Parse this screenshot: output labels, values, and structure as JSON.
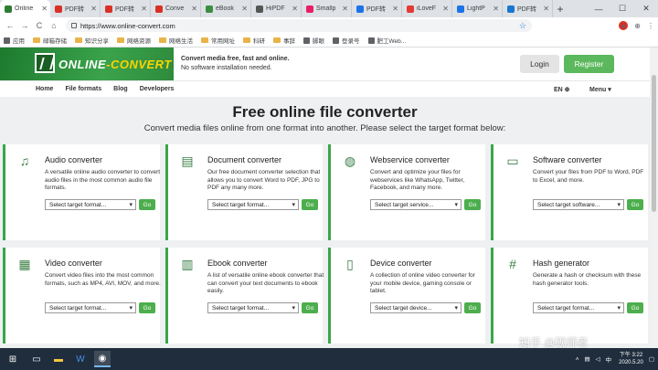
{
  "browser": {
    "tabs": [
      {
        "title": "Online",
        "color": "#2e7d32",
        "active": true
      },
      {
        "title": "PDF转",
        "color": "#d93025",
        "active": false
      },
      {
        "title": "PDF转",
        "color": "#d93025",
        "active": false
      },
      {
        "title": "Conve",
        "color": "#d93025",
        "active": false
      },
      {
        "title": "eBook",
        "color": "#3c8d40",
        "active": false
      },
      {
        "title": "HiPDF",
        "color": "#555555",
        "active": false
      },
      {
        "title": "Smallp",
        "color": "#e91e63",
        "active": false
      },
      {
        "title": "PDF转",
        "color": "#1a73e8",
        "active": false
      },
      {
        "title": "iLoveF",
        "color": "#e53935",
        "active": false
      },
      {
        "title": "LightP",
        "color": "#1a73e8",
        "active": false
      },
      {
        "title": "PDF转",
        "color": "#1976d2",
        "active": false
      }
    ],
    "new_tab": "+",
    "window_controls": [
      "—",
      "☐",
      "✕"
    ],
    "url": "https://www.online-convert.com",
    "nav": [
      "←",
      "→",
      "C",
      "⌂"
    ],
    "toolbar_icons": [
      "☆",
      "⊕",
      "⋮"
    ],
    "bookmarks": [
      {
        "label": "应用",
        "type": "apps"
      },
      {
        "label": "邮箱存储",
        "type": "folder"
      },
      {
        "label": "知识分享",
        "type": "folder"
      },
      {
        "label": "网络资源",
        "type": "folder"
      },
      {
        "label": "网络生活",
        "type": "folder"
      },
      {
        "label": "常用网址",
        "type": "folder"
      },
      {
        "label": "科研",
        "type": "folder"
      },
      {
        "label": "事辞",
        "type": "folder"
      },
      {
        "label": "脚眼",
        "type": "link"
      },
      {
        "label": "登录号",
        "type": "link"
      },
      {
        "label": "肥工Web...",
        "type": "link"
      }
    ]
  },
  "site": {
    "logo_text_a": "ONLINE",
    "logo_text_b": "-CONVERT",
    "tagline_1": "Convert media free, fast and online.",
    "tagline_2": "No software installation needed.",
    "login": "Login",
    "register": "Register",
    "nav": [
      "Home",
      "File formats",
      "Blog",
      "Developers"
    ],
    "lang": "EN ⊕",
    "menu": "Menu ▾",
    "hero_title": "Free online file converter",
    "hero_sub": "Convert media files online from one format into another. Please select the target format below:",
    "go_label": "Go",
    "cards": [
      {
        "title": "Audio converter",
        "desc": "A versatile online audio converter to convert audio files in the most common audio file formats.",
        "select": "Select target format...",
        "icon": "♫"
      },
      {
        "title": "Document converter",
        "desc": "Our free document converter selection that allows you to convert Word to PDF, JPG to PDF any many more.",
        "select": "Select target format...",
        "icon": "▤"
      },
      {
        "title": "Webservice converter",
        "desc": "Convert and optimize your files for webservices like WhatsApp, Twitter, Facebook, and many more.",
        "select": "Select target service...",
        "icon": "◍"
      },
      {
        "title": "Software converter",
        "desc": "Convert your files from PDF to Word, PDF to Excel, and more.",
        "select": "Select target software...",
        "icon": "▭"
      },
      {
        "title": "Video converter",
        "desc": "Convert video files into the most common formats, such as MP4, AVI, MOV, and more.",
        "select": "Select target format...",
        "icon": "▦"
      },
      {
        "title": "Ebook converter",
        "desc": "A list of versatile online ebook converter that can convert your text documents to ebook easily.",
        "select": "Select target format...",
        "icon": "▥"
      },
      {
        "title": "Device converter",
        "desc": "A collection of online video converter for your mobile device, gaming console or tablet.",
        "select": "Select target device...",
        "icon": "▯"
      },
      {
        "title": "Hash generator",
        "desc": "Generate a hash or checksum with these hash generator tools.",
        "select": "Select target format...",
        "icon": "#"
      }
    ]
  },
  "taskbar": {
    "time": "下午 3:22",
    "date": "2020.5.20",
    "ime": "中"
  },
  "watermark": "知乎 @砚师者"
}
